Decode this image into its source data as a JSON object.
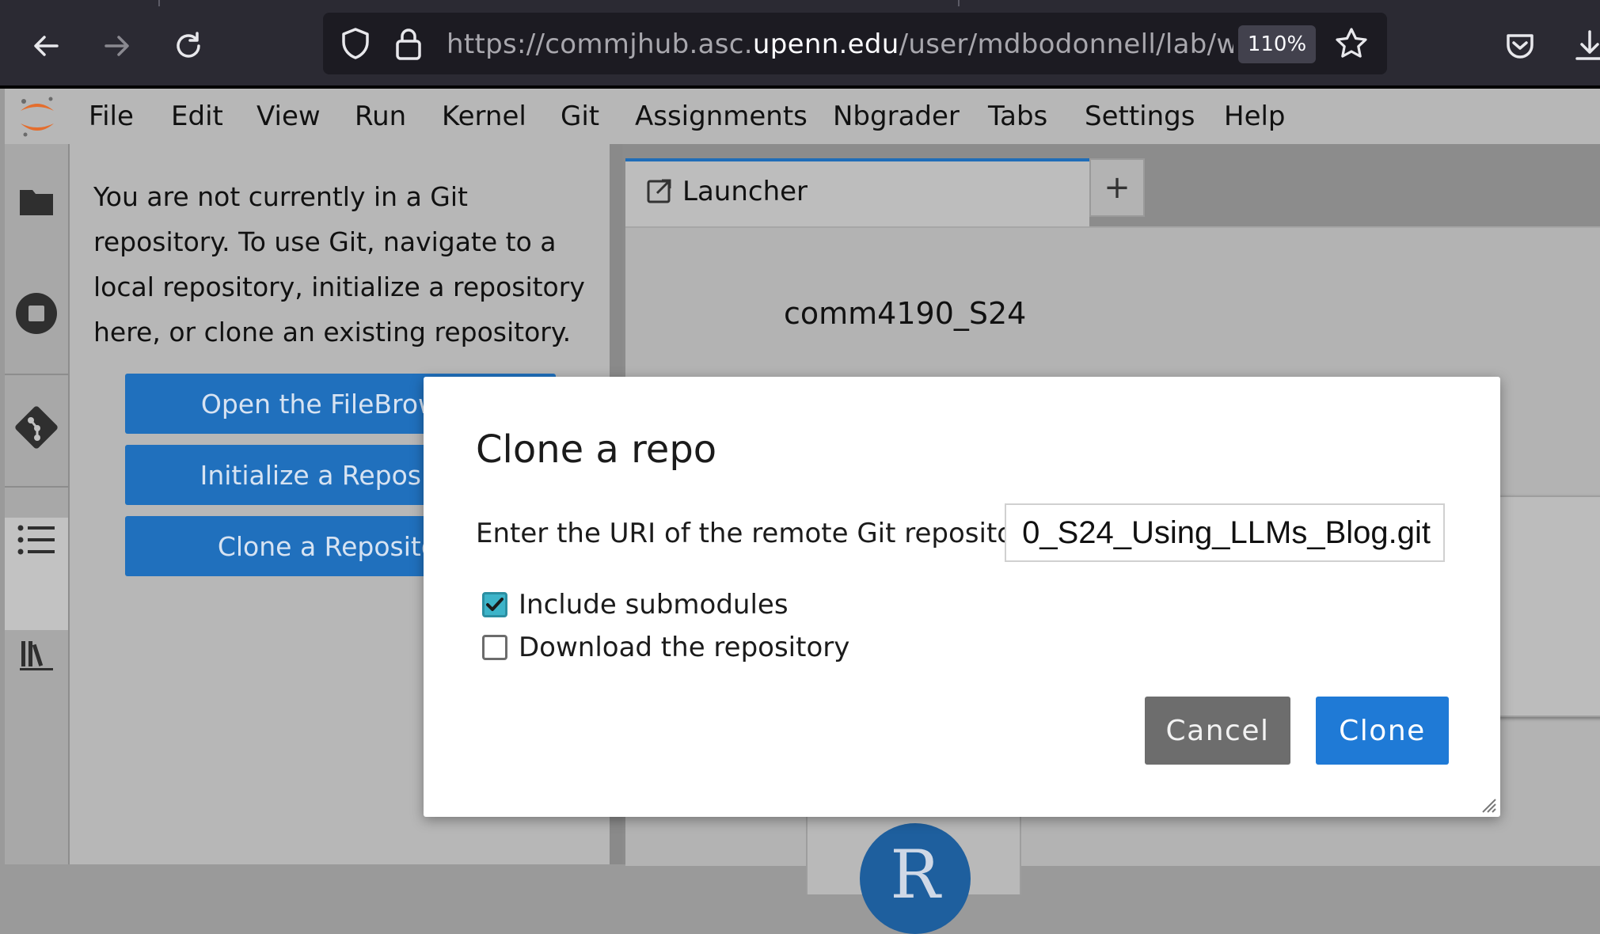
{
  "browser": {
    "url_prefix": "https://commjhub.asc.",
    "url_domain": "upenn.edu",
    "url_path": "/user/mdbodonnell/lab/wo",
    "zoom": "110%"
  },
  "menu": [
    "File",
    "Edit",
    "View",
    "Run",
    "Kernel",
    "Git",
    "Assignments",
    "Nbgrader",
    "Tabs",
    "Settings",
    "Help"
  ],
  "sidebar": {
    "message": "You are not currently in a Git repository. To use Git, navigate to a local repository, initialize a repository here, or clone an existing repository.",
    "buttons": [
      "Open the FileBrowser",
      "Initialize a Repository",
      "Clone a Repository"
    ]
  },
  "launcher": {
    "tab_label": "Launcher",
    "add_tab": "+",
    "heading": "comm4190_S24",
    "r_logo": "R"
  },
  "dialog": {
    "title": "Clone a repo",
    "uri_label": "Enter the URI of the remote Git repository",
    "uri_value": "0_S24_Using_LLMs_Blog.git",
    "include_submodules": "Include submodules",
    "include_submodules_checked": true,
    "download_repo": "Download the repository",
    "download_repo_checked": false,
    "cancel_label": "Cancel",
    "clone_label": "Clone"
  },
  "colors": {
    "accent_blue": "#1f7ad6",
    "checkbox_teal": "#3db4c9",
    "browser_dark": "#2b2a33"
  },
  "icons": [
    "back-arrow-icon",
    "forward-arrow-icon",
    "reload-icon",
    "shield-icon",
    "lock-icon",
    "star-icon",
    "pocket-icon",
    "download-icon",
    "jupyter-logo",
    "folder-icon",
    "stop-icon",
    "git-icon",
    "list-icon",
    "books-icon",
    "launcher-tab-icon",
    "checkmark-icon",
    "resize-grip-icon"
  ]
}
